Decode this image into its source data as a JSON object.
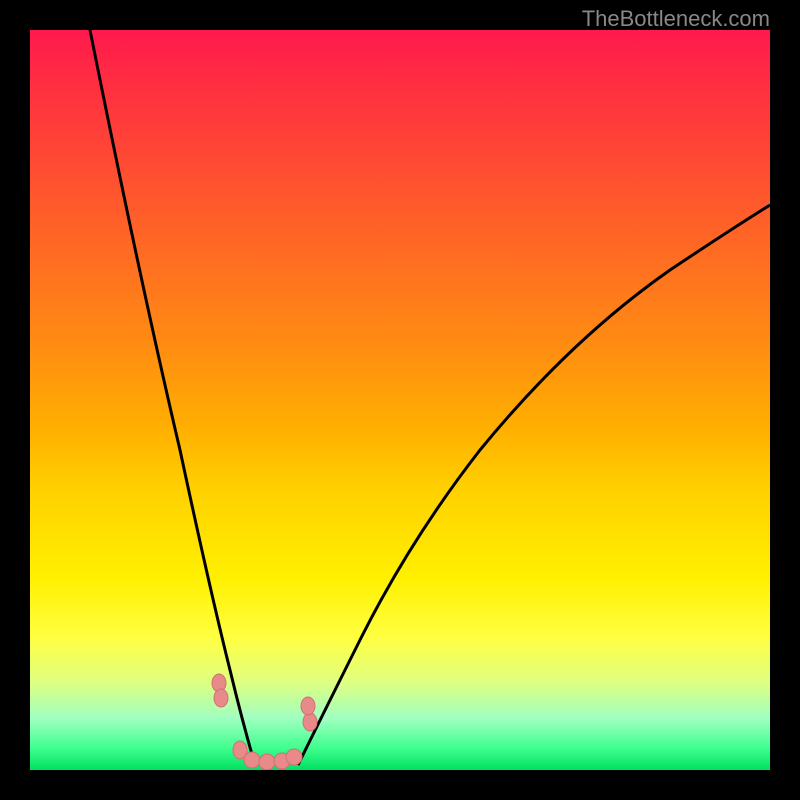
{
  "watermark": "TheBottleneck.com",
  "chart_data": {
    "type": "line",
    "title": "",
    "xlabel": "",
    "ylabel": "",
    "xlim": [
      0,
      100
    ],
    "ylim": [
      0,
      100
    ],
    "background": "gradient red-yellow-green",
    "series": [
      {
        "name": "left-curve",
        "x": [
          8,
          12,
          16,
          20,
          22,
          24,
          26,
          28,
          30
        ],
        "y": [
          100,
          82,
          62,
          40,
          28,
          18,
          10,
          4,
          0
        ]
      },
      {
        "name": "right-curve",
        "x": [
          36,
          40,
          45,
          50,
          56,
          64,
          74,
          86,
          100
        ],
        "y": [
          0,
          6,
          14,
          24,
          34,
          46,
          58,
          68,
          76
        ]
      }
    ],
    "markers": {
      "name": "pink-dots",
      "color": "#e89090",
      "points": [
        {
          "x": 25,
          "y": 12
        },
        {
          "x": 25,
          "y": 10
        },
        {
          "x": 28,
          "y": 2
        },
        {
          "x": 30,
          "y": 1
        },
        {
          "x": 32,
          "y": 1
        },
        {
          "x": 34,
          "y": 1
        },
        {
          "x": 35,
          "y": 2
        },
        {
          "x": 37,
          "y": 7
        },
        {
          "x": 37,
          "y": 9
        }
      ]
    }
  }
}
